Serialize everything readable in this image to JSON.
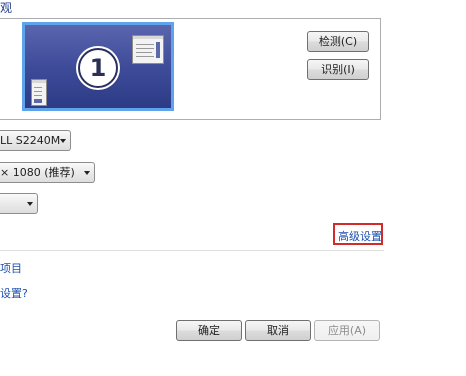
{
  "section": {
    "title": "观"
  },
  "preview": {
    "monitor_number": "1"
  },
  "buttons": {
    "detect": "检测(C)",
    "identify": "识别(I)",
    "ok": "确定",
    "cancel": "取消",
    "apply": "应用(A)"
  },
  "display": {
    "monitor_select": "LL S2240M",
    "resolution_select": "× 1080 (推荐)",
    "orientation_select": ""
  },
  "links": {
    "advanced": "高级设置",
    "item1": "项目",
    "item2": "设置?"
  },
  "icons": {
    "dropdown": "chevron-down-icon"
  }
}
